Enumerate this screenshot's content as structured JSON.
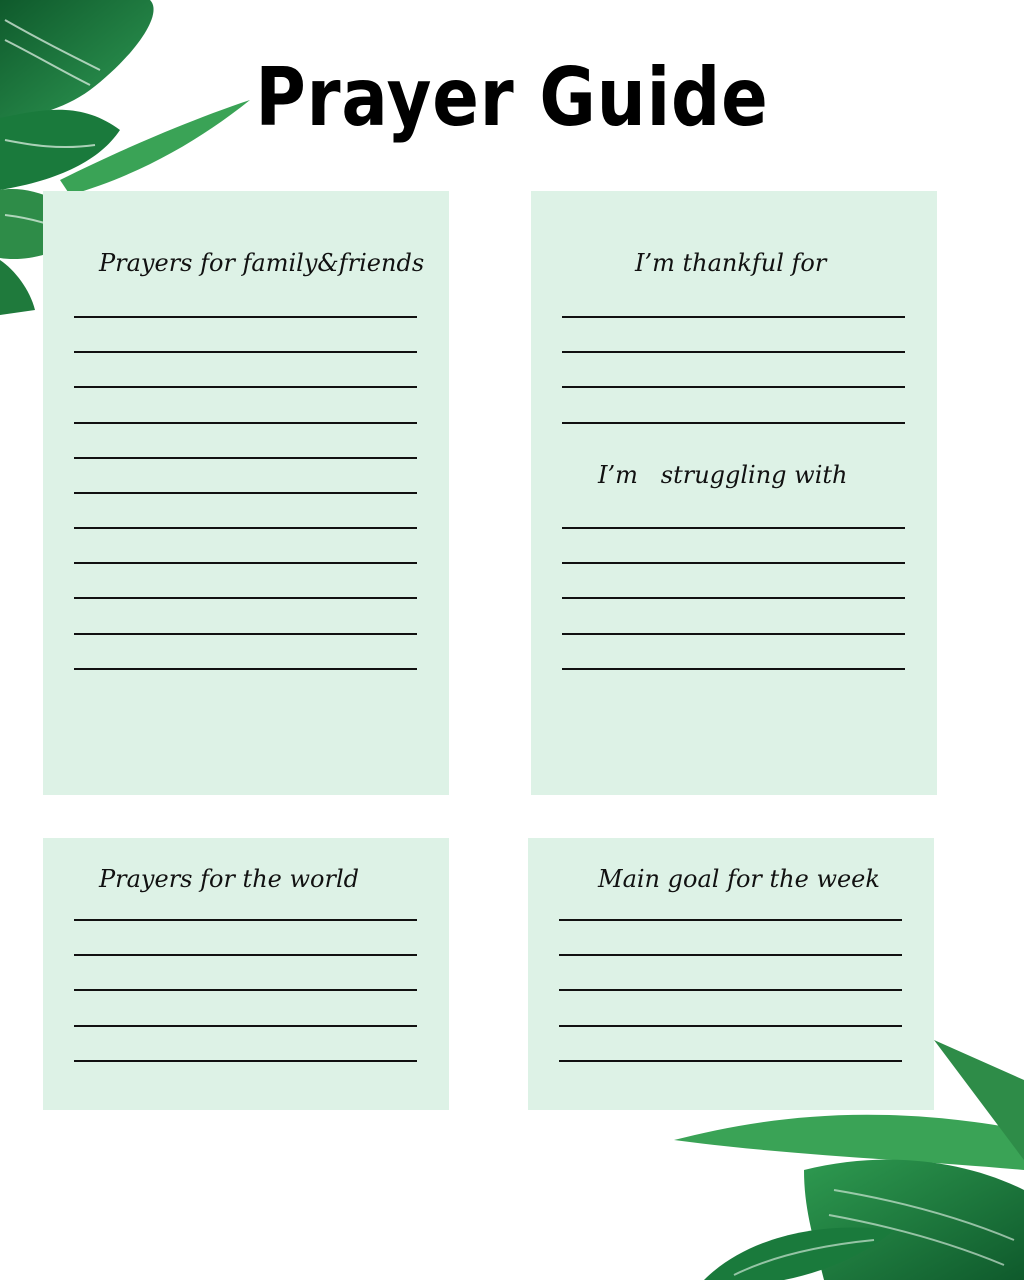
{
  "page": {
    "title": "Prayer Guide",
    "accent_color": "#ddf2e6",
    "leaf_color": "#1f7a3c"
  },
  "sections": {
    "family": {
      "label": "Prayers for family&friends",
      "line_count": 11
    },
    "thankful": {
      "label": "I’m thankful for",
      "line_count": 4
    },
    "struggling": {
      "label": "I’m   struggling with",
      "line_count": 5
    },
    "world": {
      "label": "Prayers for the world",
      "line_count": 5
    },
    "goal": {
      "label": "Main goal for the week",
      "line_count": 5
    }
  },
  "decorations": [
    "palm-leaves-top-left",
    "palm-leaves-bottom-right"
  ]
}
